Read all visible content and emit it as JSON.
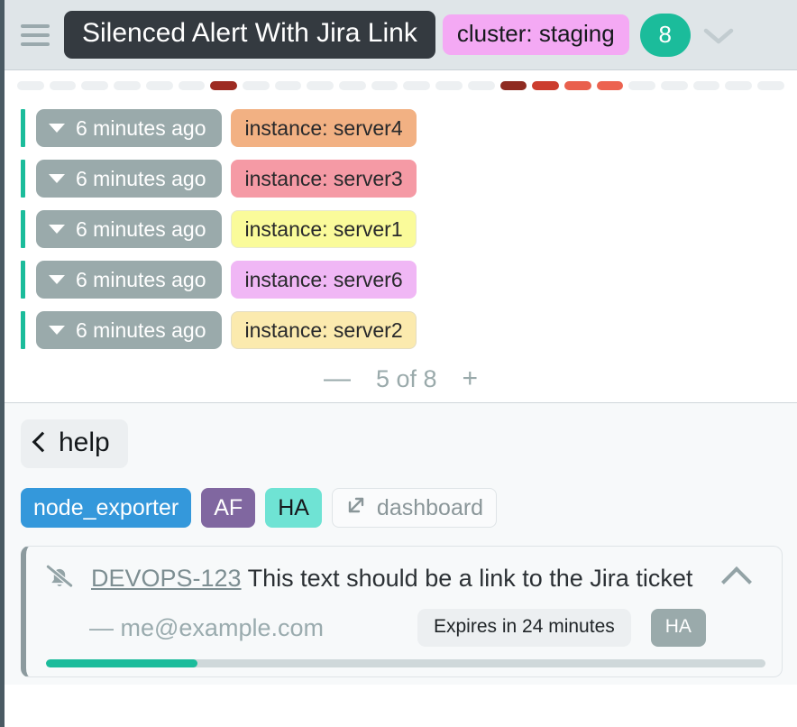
{
  "header": {
    "menu_icon": "hamburger-menu-icon",
    "title": "Silenced Alert With Jira Link",
    "cluster_label": "cluster: staging",
    "count": "8",
    "expand_icon": "chevron-down-icon",
    "colors": {
      "title_bg": "#343a40",
      "cluster_bg": "#f4a9f4",
      "count_bg": "#1bbc9b",
      "header_bg": "#dfe5e8"
    }
  },
  "dash_strip": {
    "segments": [
      {
        "color": "#edf0f2",
        "state": "empty"
      },
      {
        "color": "#edf0f2",
        "state": "empty"
      },
      {
        "color": "#edf0f2",
        "state": "empty"
      },
      {
        "color": "#edf0f2",
        "state": "empty"
      },
      {
        "color": "#edf0f2",
        "state": "empty"
      },
      {
        "color": "#edf0f2",
        "state": "empty"
      },
      {
        "color": "#9d2b22",
        "state": "firing"
      },
      {
        "color": "#edf0f2",
        "state": "empty"
      },
      {
        "color": "#edf0f2",
        "state": "empty"
      },
      {
        "color": "#edf0f2",
        "state": "empty"
      },
      {
        "color": "#edf0f2",
        "state": "empty"
      },
      {
        "color": "#edf0f2",
        "state": "empty"
      },
      {
        "color": "#edf0f2",
        "state": "empty"
      },
      {
        "color": "#edf0f2",
        "state": "empty"
      },
      {
        "color": "#edf0f2",
        "state": "empty"
      },
      {
        "color": "#8f2b21",
        "state": "firing"
      },
      {
        "color": "#cc3d2e",
        "state": "firing"
      },
      {
        "color": "#e9604d",
        "state": "firing"
      },
      {
        "color": "#ec6350",
        "state": "firing"
      },
      {
        "color": "#edf0f2",
        "state": "empty"
      },
      {
        "color": "#edf0f2",
        "state": "empty"
      },
      {
        "color": "#edf0f2",
        "state": "empty"
      },
      {
        "color": "#edf0f2",
        "state": "empty"
      },
      {
        "color": "#edf0f2",
        "state": "empty"
      }
    ]
  },
  "alerts": {
    "rows": [
      {
        "time": "6 minutes ago",
        "instance": "instance: server4",
        "bg": "#f2b183",
        "border": "transparent"
      },
      {
        "time": "6 minutes ago",
        "instance": "instance: server3",
        "bg": "#f59aa5",
        "border": "transparent"
      },
      {
        "time": "6 minutes ago",
        "instance": "instance: server1",
        "bg": "#fafb9a",
        "border": "#e8e9ce"
      },
      {
        "time": "6 minutes ago",
        "instance": "instance: server6",
        "bg": "#f0b7f5",
        "border": "transparent"
      },
      {
        "time": "6 minutes ago",
        "instance": "instance: server2",
        "bg": "#fbeaae",
        "border": "#e4ddc2"
      }
    ],
    "accent_color": "#1bbc9b",
    "time_pill_bg": "#9aaaab"
  },
  "pagination": {
    "decrease_label": "—",
    "page_label": "5 of 8",
    "increase_label": "+"
  },
  "lower": {
    "help_label": "help",
    "back_icon": "chevron-left-icon",
    "tags": [
      {
        "label": "node_exporter",
        "style": "blue",
        "color": "#3498db"
      },
      {
        "label": "AF",
        "style": "purple",
        "color": "#8067a0"
      },
      {
        "label": "HA",
        "style": "teal",
        "color": "#6fe3d4"
      }
    ],
    "dashboard": {
      "label": "dashboard",
      "icon": "external-link-icon"
    }
  },
  "jira_card": {
    "silence_icon": "bell-slash-icon",
    "ticket_id": "DEVOPS-123",
    "description": "This text should be a link to the Jira ticket",
    "collapse_icon": "chevron-up-icon",
    "author": "— me@example.com",
    "expires_label": "Expires in 24 minutes",
    "ha_chip": "HA",
    "progress_percent": 21,
    "progress_color": "#1bbc9b"
  }
}
